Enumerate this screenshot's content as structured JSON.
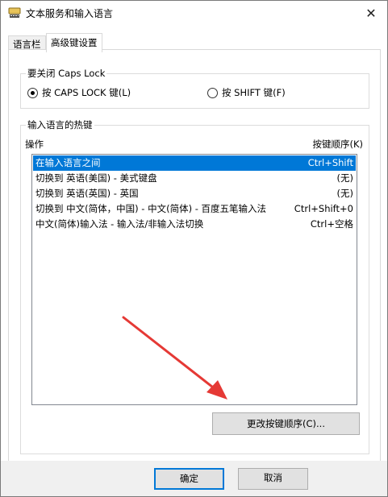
{
  "window": {
    "title": "文本服务和输入语言",
    "close_glyph": "✕"
  },
  "tabs": [
    {
      "label": "语言栏"
    },
    {
      "label": "高级键设置"
    }
  ],
  "caps_group": {
    "label": "要关闭 Caps Lock",
    "options": [
      {
        "label": "按 CAPS LOCK 键(L)",
        "selected": true
      },
      {
        "label": "按 SHIFT 键(F)",
        "selected": false
      }
    ]
  },
  "hotkeys_group": {
    "label": "输入语言的热键",
    "col_action": "操作",
    "col_order": "按键顺序(K)",
    "rows": [
      {
        "action": "在输入语言之间",
        "keys": "Ctrl+Shift"
      },
      {
        "action": "切换到 英语(美国) - 美式键盘",
        "keys": "(无)"
      },
      {
        "action": "切换到 英语(英国) - 英国",
        "keys": "(无)"
      },
      {
        "action": "切换到 中文(简体，中国) - 中文(简体) - 百度五笔输入法",
        "keys": "Ctrl+Shift+0"
      },
      {
        "action": "中文(简体)输入法 - 输入法/非输入法切换",
        "keys": "Ctrl+空格"
      }
    ],
    "change_order_button": "更改按键顺序(C)..."
  },
  "footer": {
    "ok": "确定",
    "cancel": "取消"
  },
  "colors": {
    "selection": "#0078d7",
    "arrow": "#e53935"
  }
}
